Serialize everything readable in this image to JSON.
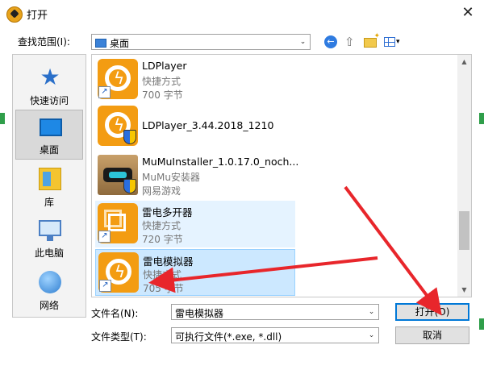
{
  "dialog": {
    "title": "打开",
    "close_glyph": "✕"
  },
  "look_in": {
    "label": "查找范围(I):",
    "value": "桌面"
  },
  "toolbar": {
    "back_glyph": "←",
    "up_glyph": "⇧",
    "caret_glyph": "▾"
  },
  "places": [
    {
      "label": "快速访问",
      "icon": "star-icon"
    },
    {
      "label": "桌面",
      "icon": "desktop-icon",
      "selected": true
    },
    {
      "label": "库",
      "icon": "library-icon"
    },
    {
      "label": "此电脑",
      "icon": "computer-icon"
    },
    {
      "label": "网络",
      "icon": "network-icon"
    }
  ],
  "files": [
    {
      "name": "LDPlayer",
      "type": "快捷方式",
      "size": "700 字节",
      "icon": "ldplayer-icon",
      "shortcut": true
    },
    {
      "name": "LDPlayer_3.44.2018_1210",
      "icon": "ldplayer-icon",
      "shield": true
    },
    {
      "name": "MuMuInstaller_1.0.17.0_noch...",
      "type": "MuMu安装器",
      "size": "网易游戏",
      "icon": "mumu-icon",
      "shield": true
    },
    {
      "name": "雷电多开器",
      "type": "快捷方式",
      "size": "720 字节",
      "icon": "multi-open-icon",
      "shortcut": true,
      "state": "hover"
    },
    {
      "name": "雷电模拟器",
      "type": "快捷方式",
      "size": "705 字节",
      "icon": "ldplayer-icon",
      "shortcut": true,
      "state": "selected"
    }
  ],
  "filename": {
    "label": "文件名(N):",
    "value": "雷电模拟器"
  },
  "filetype": {
    "label": "文件类型(T):",
    "value": "可执行文件(*.exe, *.dll)"
  },
  "buttons": {
    "open": "打开(O)",
    "cancel": "取消"
  },
  "glyphs": {
    "shortcut_arrow": "↗",
    "combo_arrow": "⌄",
    "scroll_up": "▲",
    "scroll_down": "▼",
    "star": "★",
    "bolt": "ϟ"
  },
  "colors": {
    "accent": "#0078d7",
    "selection": "#cce8ff",
    "hover": "#e5f3ff",
    "annotation_arrow": "#e8262b",
    "app_orange": "#f39c12"
  }
}
